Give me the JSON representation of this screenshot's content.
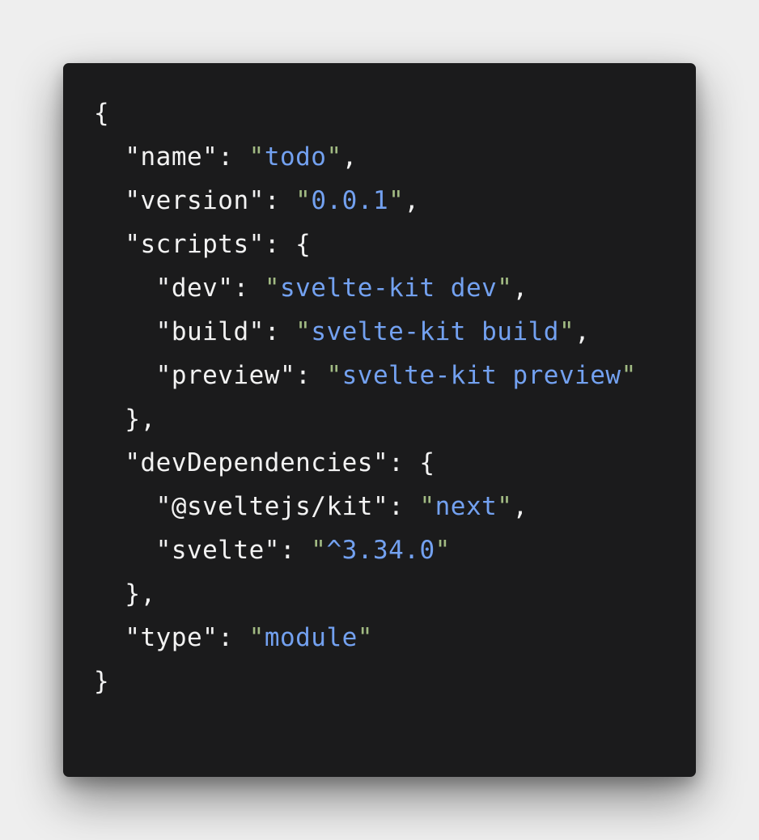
{
  "colors": {
    "background": "#eeeeee",
    "editor_background": "#1b1b1c",
    "text": "#f2f2f2",
    "string": "#73a1f0",
    "string_quote": "#a2bb83"
  },
  "code": {
    "lines": [
      {
        "indent": "",
        "tokens": [
          {
            "type": "punct",
            "text": "{"
          }
        ]
      },
      {
        "indent": "  ",
        "tokens": [
          {
            "type": "key",
            "text": "\"name\""
          },
          {
            "type": "punct",
            "text": ": "
          },
          {
            "type": "quote",
            "text": "\""
          },
          {
            "type": "str",
            "text": "todo"
          },
          {
            "type": "quote",
            "text": "\""
          },
          {
            "type": "punct",
            "text": ","
          }
        ]
      },
      {
        "indent": "  ",
        "tokens": [
          {
            "type": "key",
            "text": "\"version\""
          },
          {
            "type": "punct",
            "text": ": "
          },
          {
            "type": "quote",
            "text": "\""
          },
          {
            "type": "str",
            "text": "0.0.1"
          },
          {
            "type": "quote",
            "text": "\""
          },
          {
            "type": "punct",
            "text": ","
          }
        ]
      },
      {
        "indent": "  ",
        "tokens": [
          {
            "type": "key",
            "text": "\"scripts\""
          },
          {
            "type": "punct",
            "text": ": {"
          }
        ]
      },
      {
        "indent": "    ",
        "tokens": [
          {
            "type": "key",
            "text": "\"dev\""
          },
          {
            "type": "punct",
            "text": ": "
          },
          {
            "type": "quote",
            "text": "\""
          },
          {
            "type": "str",
            "text": "svelte-kit dev"
          },
          {
            "type": "quote",
            "text": "\""
          },
          {
            "type": "punct",
            "text": ","
          }
        ]
      },
      {
        "indent": "    ",
        "tokens": [
          {
            "type": "key",
            "text": "\"build\""
          },
          {
            "type": "punct",
            "text": ": "
          },
          {
            "type": "quote",
            "text": "\""
          },
          {
            "type": "str",
            "text": "svelte-kit build"
          },
          {
            "type": "quote",
            "text": "\""
          },
          {
            "type": "punct",
            "text": ","
          }
        ]
      },
      {
        "indent": "    ",
        "tokens": [
          {
            "type": "key",
            "text": "\"preview\""
          },
          {
            "type": "punct",
            "text": ": "
          },
          {
            "type": "quote",
            "text": "\""
          },
          {
            "type": "str",
            "text": "svelte-kit preview"
          },
          {
            "type": "quote",
            "text": "\""
          }
        ]
      },
      {
        "indent": "  ",
        "tokens": [
          {
            "type": "punct",
            "text": "},"
          }
        ]
      },
      {
        "indent": "  ",
        "tokens": [
          {
            "type": "key",
            "text": "\"devDependencies\""
          },
          {
            "type": "punct",
            "text": ": {"
          }
        ]
      },
      {
        "indent": "    ",
        "tokens": [
          {
            "type": "key",
            "text": "\"@sveltejs/kit\""
          },
          {
            "type": "punct",
            "text": ": "
          },
          {
            "type": "quote",
            "text": "\""
          },
          {
            "type": "str",
            "text": "next"
          },
          {
            "type": "quote",
            "text": "\""
          },
          {
            "type": "punct",
            "text": ","
          }
        ]
      },
      {
        "indent": "    ",
        "tokens": [
          {
            "type": "key",
            "text": "\"svelte\""
          },
          {
            "type": "punct",
            "text": ": "
          },
          {
            "type": "quote",
            "text": "\""
          },
          {
            "type": "str",
            "text": "^3.34.0"
          },
          {
            "type": "quote",
            "text": "\""
          }
        ]
      },
      {
        "indent": "  ",
        "tokens": [
          {
            "type": "punct",
            "text": "},"
          }
        ]
      },
      {
        "indent": "  ",
        "tokens": [
          {
            "type": "key",
            "text": "\"type\""
          },
          {
            "type": "punct",
            "text": ": "
          },
          {
            "type": "quote",
            "text": "\""
          },
          {
            "type": "str",
            "text": "module"
          },
          {
            "type": "quote",
            "text": "\""
          }
        ]
      },
      {
        "indent": "",
        "tokens": [
          {
            "type": "punct",
            "text": "}"
          }
        ]
      }
    ]
  }
}
